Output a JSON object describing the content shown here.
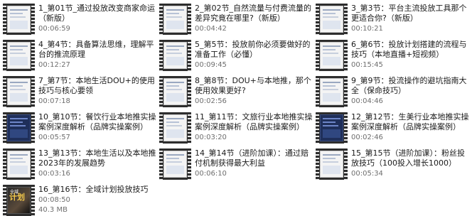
{
  "files": [
    {
      "name": "1_第01节_通过投放改变商家命运（新版）",
      "meta": "00:06:59",
      "thumb": "doc"
    },
    {
      "name": "2_第02节_自然流量与付费流量的差异究竟在哪里?（新版）",
      "meta": "00:04:42",
      "thumb": "doc"
    },
    {
      "name": "3_第3节：平台主流投放工具那个更适合你?（新版）",
      "meta": "00:10:21",
      "thumb": "doc"
    },
    {
      "name": "4_第4节：具备算法思维，理解平台的推流原理",
      "meta": "00:12:27",
      "thumb": "doc"
    },
    {
      "name": "5_第5节：投放前你必须要做好的准备工作（必懂）",
      "meta": "00:09:45",
      "thumb": "doc"
    },
    {
      "name": "6_第6节：投放计划搭建的流程与技巧（本地直播+短视频）",
      "meta": "00:15:45",
      "thumb": "doc"
    },
    {
      "name": "7_第7节：本地生活DOU+的使用技巧与核心要领",
      "meta": "00:07:18",
      "thumb": "doc"
    },
    {
      "name": "8_第8节：DOU+与本地推，那个使用效果更好?",
      "meta": "00:02:56",
      "thumb": "doc"
    },
    {
      "name": "9_第9节：投流操作的避坑指南大全（保命技巧）",
      "meta": "00:04:46",
      "thumb": "doc"
    },
    {
      "name": "10_第10节：餐饮行业本地推实操案例深度解析（品牌实操案例）",
      "meta": "00:05:57",
      "thumb": "dark"
    },
    {
      "name": "11_第11节：文旅行业本地推实操案例深度解析（品牌实操案例）",
      "meta": "00:03:20",
      "thumb": "doc"
    },
    {
      "name": "12_第12节：生美行业本地推实操案例深度解析（品牌实操案例）",
      "meta": "00:02:46",
      "thumb": "dark"
    },
    {
      "name": "13_第13节：本地生活以及本地推2023年的发展趋势",
      "meta": "00:03:16",
      "thumb": "doc"
    },
    {
      "name": "14_第14节（进阶加课）：通过赔付机制获得最大利益",
      "meta": "00:06:10",
      "thumb": "doc"
    },
    {
      "name": "15_第15节（进阶加课）：粉丝投放技巧（100投入增长1000）",
      "meta": "00:05:34",
      "thumb": "doc"
    },
    {
      "name": "16_第16节：全域计划投放技巧",
      "meta": "00:08:50",
      "meta2": "40.3 MB",
      "thumb": "photo",
      "thumb_text": "计划",
      "thumb_small": "全域"
    }
  ]
}
